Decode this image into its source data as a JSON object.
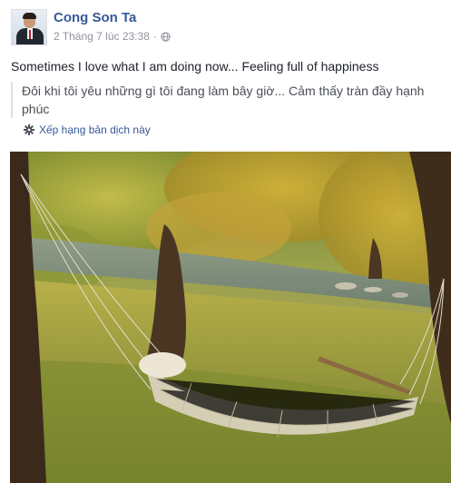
{
  "post": {
    "author": "Cong Son Ta",
    "timestamp": "2 Tháng 7 lúc 23:38",
    "separator": "·",
    "privacy_icon": "globe-icon",
    "text": "Sometimes I love what I am doing now... Feeling full of happiness",
    "translation": "Đôi khi tôi yêu những gì tôi đang làm bây giờ... Cảm thấy tràn đầy hạnh phúc",
    "translate_link": "Xếp hạng bản dịch này",
    "translate_icon": "gear-icon"
  },
  "colors": {
    "link": "#365899",
    "meta": "#90949c",
    "text": "#1d2129"
  }
}
